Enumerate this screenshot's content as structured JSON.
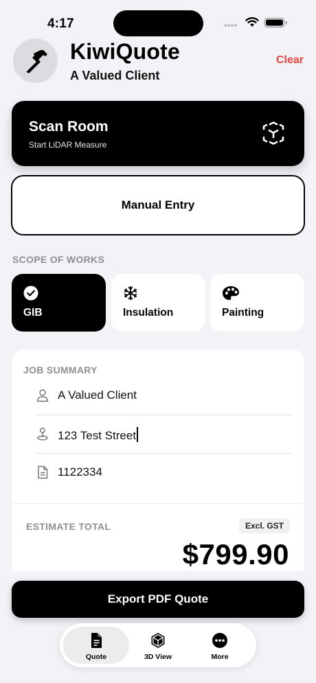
{
  "status_bar": {
    "time": "4:17"
  },
  "header": {
    "title": "KiwiQuote",
    "subtitle": "A Valued Client",
    "clear_label": "Clear",
    "avatar_icon": "hammer-icon"
  },
  "scan_room": {
    "title": "Scan Room",
    "subtitle": "Start LiDAR Measure",
    "icon": "ar-cube-icon"
  },
  "manual_entry": {
    "label": "Manual Entry"
  },
  "scope": {
    "section_label": "SCOPE OF WORKS",
    "items": [
      {
        "label": "GIB",
        "icon": "checkmark-circle-icon",
        "selected": true
      },
      {
        "label": "Insulation",
        "icon": "snowflake-icon",
        "selected": false
      },
      {
        "label": "Painting",
        "icon": "palette-icon",
        "selected": false
      }
    ]
  },
  "job_summary": {
    "section_label": "JOB SUMMARY",
    "client_name": "A Valued Client",
    "address": "123 Test Street",
    "job_number": "1122334"
  },
  "estimate": {
    "label": "ESTIMATE TOTAL",
    "gst_badge": "Excl. GST",
    "total": "$799.90"
  },
  "export": {
    "label": "Export PDF Quote"
  },
  "tab_bar": {
    "tabs": [
      {
        "label": "Quote",
        "icon": "document-icon",
        "active": true
      },
      {
        "label": "3D View",
        "icon": "cube-icon",
        "active": false
      },
      {
        "label": "More",
        "icon": "ellipsis-circle-icon",
        "active": false
      }
    ]
  },
  "colors": {
    "accent_red": "#e8453c",
    "background": "#f2f2f7",
    "primary": "#000000",
    "muted_label": "#8e8e93"
  }
}
